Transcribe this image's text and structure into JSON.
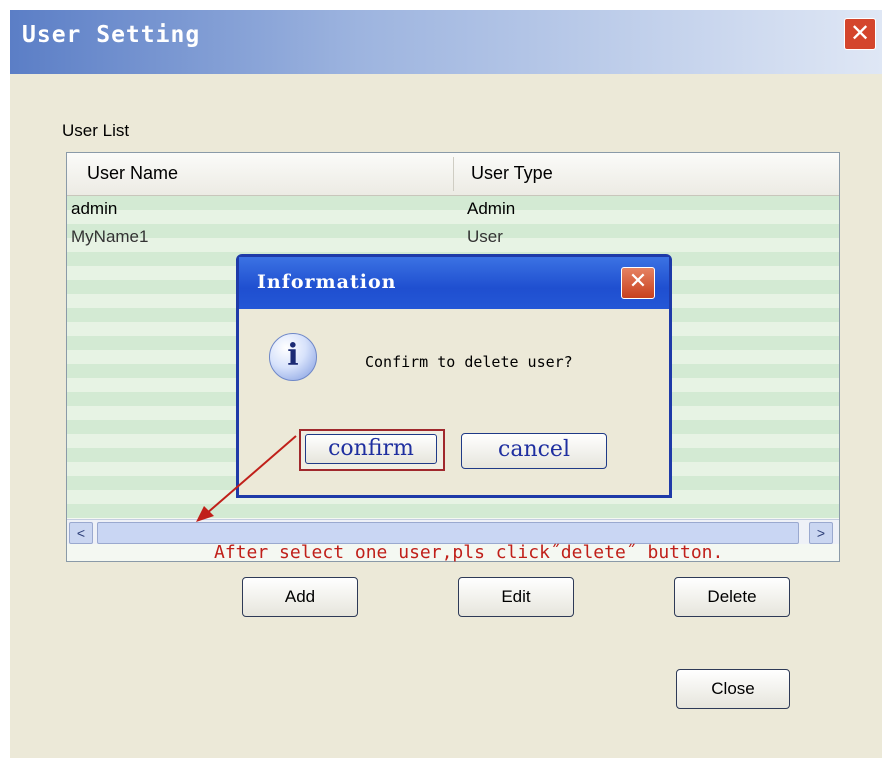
{
  "window": {
    "title": "User Setting",
    "close_glyph": "✕"
  },
  "user_list": {
    "label": "User List",
    "columns": [
      "User Name",
      "User Type"
    ],
    "rows": [
      {
        "name": "admin",
        "type": "Admin"
      },
      {
        "name": "MyName1",
        "type": "User"
      }
    ]
  },
  "scrollbar": {
    "left_arrow": "<",
    "right_arrow": ">"
  },
  "buttons": {
    "add": "Add",
    "edit": "Edit",
    "delete": "Delete",
    "close": "Close"
  },
  "dialog": {
    "title": "Information",
    "close_glyph": "✕",
    "icon": "info-icon",
    "icon_glyph": "i",
    "message": "Confirm to delete user?",
    "confirm": "confirm",
    "cancel": "cancel"
  },
  "annotation": {
    "text": "After select one user,pls click˝delete˝ button.",
    "color": "#c0201a"
  },
  "colors": {
    "title_bar": "#5b7ec6",
    "dialog_title": "#1f4fd0",
    "window_bg": "#ece9d8",
    "list_stripe": "#d3ead3"
  }
}
